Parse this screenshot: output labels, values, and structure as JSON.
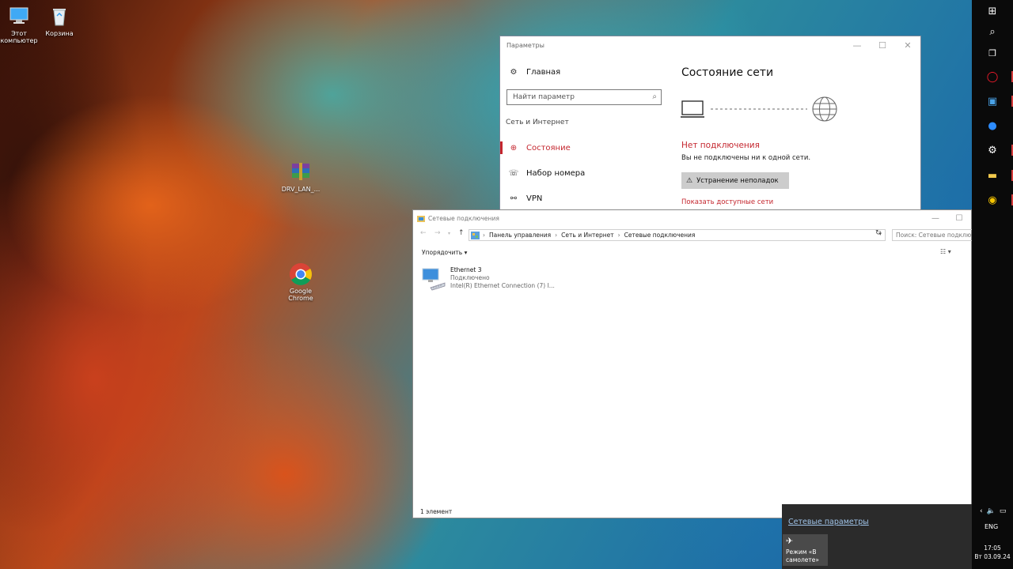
{
  "desktop": {
    "icons": [
      {
        "label": "Этот компьютер",
        "icon": "computer-icon"
      },
      {
        "label": "Корзина",
        "icon": "recycle-bin-icon"
      },
      {
        "label": "DRV_LAN_...",
        "icon": "winrar-archive-icon"
      },
      {
        "label": "Google Chrome",
        "icon": "chrome-icon"
      }
    ]
  },
  "settings": {
    "title": "Параметры",
    "home": "Главная",
    "search_placeholder": "Найти параметр",
    "section": "Сеть и Интернет",
    "nav": [
      {
        "label": "Состояние",
        "icon": "network-status-icon"
      },
      {
        "label": "Набор номера",
        "icon": "dialup-icon"
      },
      {
        "label": "VPN",
        "icon": "vpn-icon"
      }
    ],
    "page_title": "Состояние сети",
    "status_title": "Нет подключения",
    "status_sub": "Вы не подключены ни к одной сети.",
    "troubleshoot": "Устранение неполадок",
    "show_networks": "Показать доступные сети",
    "accent": "#c4262e"
  },
  "explorer": {
    "title": "Сетевые подключения",
    "path": [
      "Панель управления",
      "Сеть и Интернет",
      "Сетевые подключения"
    ],
    "search_placeholder": "Поиск: Сетевые подключения",
    "organize": "Упорядочить ▾",
    "item": {
      "name": "Ethernet 3",
      "status": "Подключено",
      "adapter": "Intel(R) Ethernet Connection (7) I..."
    },
    "statusbar": "1 элемент"
  },
  "flyout": {
    "link": "Сетевые параметры",
    "airplane": "Режим «В самолете»"
  },
  "taskbar": {
    "language": "ENG",
    "time": "17:05",
    "date": "Вт 03.09.24"
  }
}
